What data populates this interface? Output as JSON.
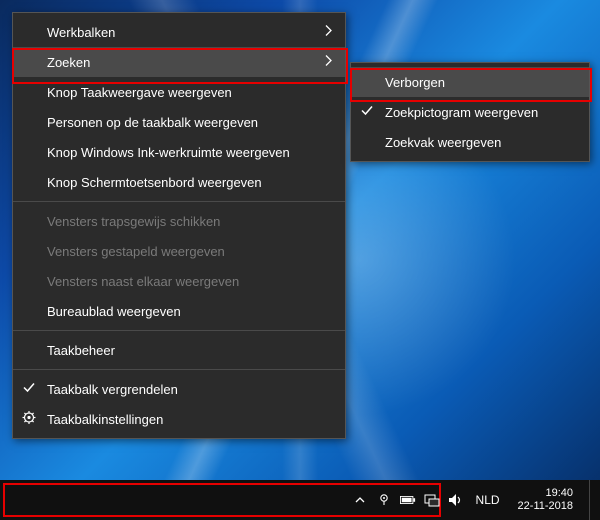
{
  "menu": {
    "main": [
      {
        "label": "Werkbalken",
        "type": "submenu"
      },
      {
        "label": "Zoeken",
        "type": "submenu",
        "hover": true
      },
      {
        "label": "Knop Taakweergave weergeven",
        "type": "item"
      },
      {
        "label": "Personen op de taakbalk weergeven",
        "type": "item"
      },
      {
        "label": "Knop Windows Ink-werkruimte weergeven",
        "type": "item"
      },
      {
        "label": "Knop Schermtoetsenbord weergeven",
        "type": "item"
      },
      {
        "type": "sep"
      },
      {
        "label": "Vensters trapsgewijs schikken",
        "type": "item",
        "disabled": true
      },
      {
        "label": "Vensters gestapeld weergeven",
        "type": "item",
        "disabled": true
      },
      {
        "label": "Vensters naast elkaar weergeven",
        "type": "item",
        "disabled": true
      },
      {
        "label": "Bureaublad weergeven",
        "type": "item"
      },
      {
        "type": "sep"
      },
      {
        "label": "Taakbeheer",
        "type": "item"
      },
      {
        "type": "sep"
      },
      {
        "label": "Taakbalk vergrendelen",
        "type": "item",
        "icon": "check"
      },
      {
        "label": "Taakbalkinstellingen",
        "type": "item",
        "icon": "gear"
      }
    ],
    "sub": [
      {
        "label": "Verborgen",
        "type": "item",
        "hover": true
      },
      {
        "label": "Zoekpictogram weergeven",
        "type": "item",
        "icon": "check"
      },
      {
        "label": "Zoekvak weergeven",
        "type": "item"
      }
    ]
  },
  "tray": {
    "lang": "NLD",
    "time": "19:40",
    "date": "22-11-2018"
  },
  "highlights": {
    "menu_item": "Zoeken",
    "submenu_item": "Verborgen",
    "taskbar_region": "search-box-area"
  },
  "colors": {
    "menu_bg": "#2b2b2b",
    "hover": "#4a4a4a",
    "accent": "#e60000"
  }
}
